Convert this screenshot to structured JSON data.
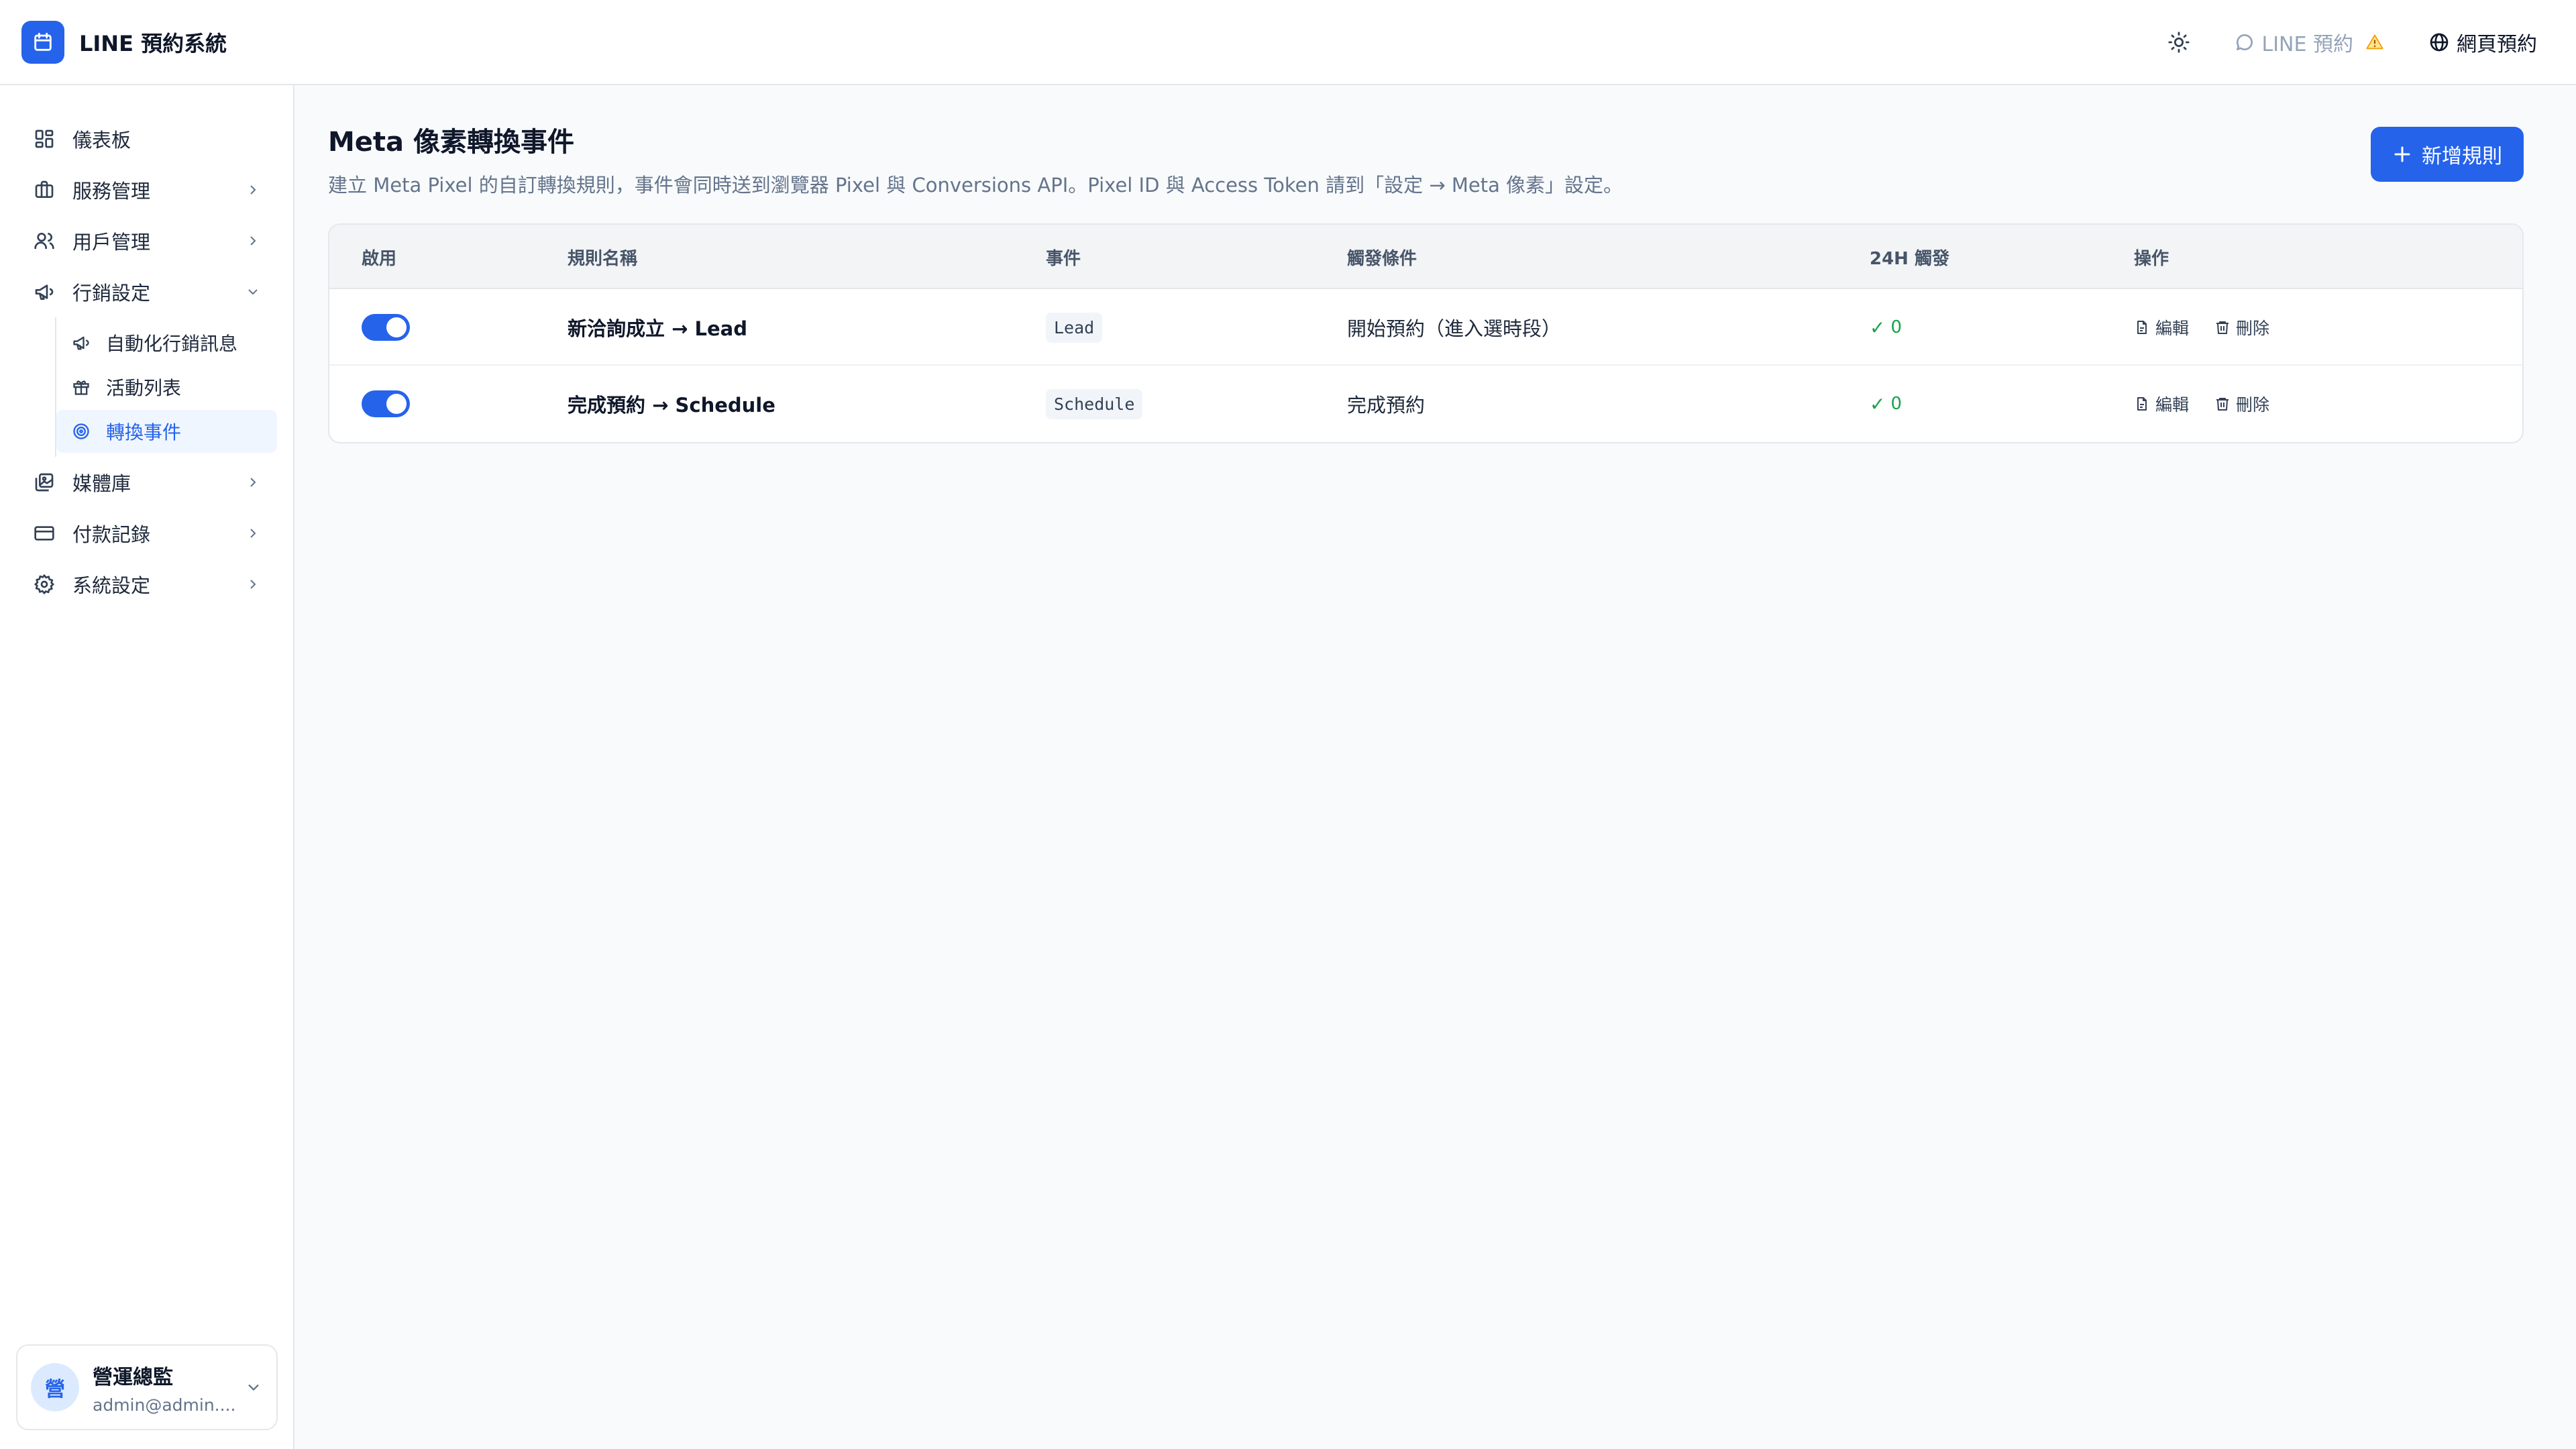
{
  "header": {
    "app_title": "LINE 預約系統",
    "line_link": "LINE 預約",
    "web_link": "網頁預約"
  },
  "sidebar": {
    "items": [
      {
        "label": "儀表板",
        "icon": "dashboard-icon"
      },
      {
        "label": "服務管理",
        "icon": "briefcase-icon"
      },
      {
        "label": "用戶管理",
        "icon": "users-icon"
      },
      {
        "label": "行銷設定",
        "icon": "megaphone-icon"
      },
      {
        "label": "媒體庫",
        "icon": "images-icon"
      },
      {
        "label": "付款記錄",
        "icon": "credit-card-icon"
      },
      {
        "label": "系統設定",
        "icon": "gear-icon"
      }
    ],
    "subitems": [
      {
        "label": "自動化行銷訊息",
        "icon": "megaphone-icon"
      },
      {
        "label": "活動列表",
        "icon": "gift-icon"
      },
      {
        "label": "轉換事件",
        "icon": "target-icon",
        "active": true
      }
    ]
  },
  "user": {
    "avatar": "營",
    "name": "營運總監",
    "email": "admin@admin...."
  },
  "page": {
    "title": "Meta 像素轉換事件",
    "subtitle": "建立 Meta Pixel 的自訂轉換規則，事件會同時送到瀏覽器 Pixel 與 Conversions API。Pixel ID 與 Access Token 請到「設定 → Meta 像素」設定。",
    "add_button": "新增規則"
  },
  "table": {
    "headers": [
      "啟用",
      "規則名稱",
      "事件",
      "觸發條件",
      "24H 觸發",
      "操作"
    ],
    "rows": [
      {
        "enabled": true,
        "name": "新洽詢成立 → Lead",
        "event": "Lead",
        "trigger": "開始預約（進入選時段）",
        "count": "0",
        "edit": "編輯",
        "delete": "刪除"
      },
      {
        "enabled": true,
        "name": "完成預約 → Schedule",
        "event": "Schedule",
        "trigger": "完成預約",
        "count": "0",
        "edit": "編輯",
        "delete": "刪除"
      }
    ]
  },
  "colors": {
    "accent": "#2563eb",
    "success": "#16a34a",
    "warning": "#f59e0b"
  }
}
